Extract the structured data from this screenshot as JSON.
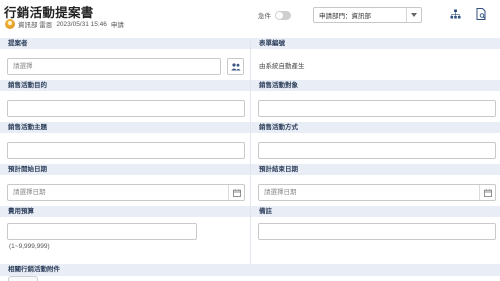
{
  "header": {
    "title": "行銷活動提案書",
    "department": "資訊部 雷恩",
    "datetime": "2023/05/31 15:46",
    "status": "申請"
  },
  "toolbar": {
    "toggle_label": "急件",
    "dept_select_value": "申請部門：資訊部",
    "icons": [
      "org-chart-icon",
      "document-search-icon"
    ]
  },
  "form": {
    "proposer": {
      "label": "提案者",
      "placeholder": "請選擇"
    },
    "form_no": {
      "label": "表單編號",
      "value": "由系統自動產生"
    },
    "purpose": {
      "label": "銷售活動目的",
      "value": ""
    },
    "target": {
      "label": "銷售活動對象",
      "value": ""
    },
    "theme": {
      "label": "銷售活動主題",
      "value": ""
    },
    "method": {
      "label": "銷售活動方式",
      "value": ""
    },
    "start_date": {
      "label": "預計開始日期",
      "placeholder": "請選擇日期"
    },
    "end_date": {
      "label": "預計結束日期",
      "placeholder": "請選擇日期"
    },
    "budget": {
      "label": "費用預算",
      "value": "",
      "hint": "(1~9,999,999)"
    },
    "note": {
      "label": "備註",
      "value": ""
    },
    "attachments": {
      "label": "相關行銷活動附件"
    }
  }
}
